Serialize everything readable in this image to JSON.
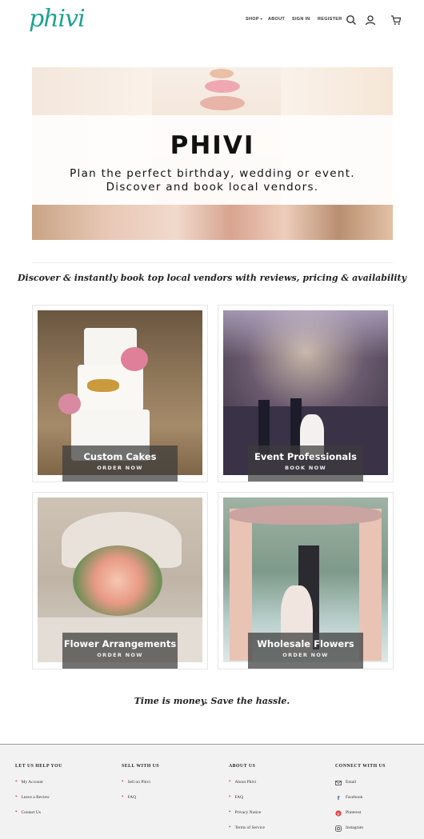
{
  "header": {
    "logo": "phivi",
    "nav": [
      "SHOP",
      "ABOUT",
      "SIGN IN",
      "REGISTER"
    ],
    "icons": [
      "search-icon",
      "user-icon",
      "cart-icon"
    ]
  },
  "hero": {
    "title": "PHIVI",
    "subtitle_line1": "Plan the perfect birthday, wedding or event.",
    "subtitle_line2": "Discover and book local vendors."
  },
  "tagline": "Discover & instantly book top local vendors with reviews, pricing & availability",
  "cards": [
    {
      "title": "Custom Cakes",
      "cta": "ORDER NOW"
    },
    {
      "title": "Event Professionals",
      "cta": "BOOK NOW"
    },
    {
      "title": "Flower Arrangements",
      "cta": "ORDER NOW"
    },
    {
      "title": "Wholesale Flowers",
      "cta": "ORDER NOW"
    }
  ],
  "closing": "Time is money. Save the hassle.",
  "footer": {
    "help": {
      "heading": "LET US HELP YOU",
      "items": [
        "My Account",
        "Leave a Review",
        "Contact Us"
      ]
    },
    "sell": {
      "heading": "SELL WITH US",
      "items": [
        "Sell on Phivi",
        "FAQ"
      ]
    },
    "about": {
      "heading": "ABOUT US",
      "items": [
        "About Phivi",
        "FAQ",
        "Privacy Notice",
        "Terms of Service"
      ]
    },
    "connect": {
      "heading": "CONNECT WITH US",
      "items": [
        "Email",
        "Facebook",
        "Pinterest",
        "Instagram"
      ]
    }
  },
  "colors": {
    "brand": "#1fa392",
    "bullet": "#e03c3c",
    "overlay": "#3c3c3c"
  }
}
